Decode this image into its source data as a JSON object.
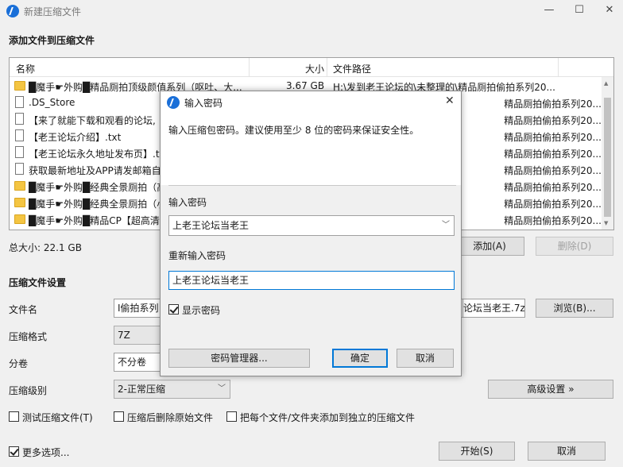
{
  "window": {
    "title": "新建压缩文件",
    "minimize": "—",
    "maximize": "☐",
    "close": "✕"
  },
  "add_section": {
    "title": "添加文件到压缩文件"
  },
  "file_list": {
    "columns": {
      "name": "名称",
      "size": "大小",
      "path": "文件路径"
    },
    "rows": [
      {
        "type": "folder",
        "name": "█魔手☛外购█精品厕拍顶级颜值系列（呕吐、大...",
        "size": "3.67 GB",
        "path": "H:\\发到老王论坛的\\未整理的\\精品厕拍偷拍系列20..."
      },
      {
        "type": "file",
        "name": ".DS_Store",
        "size": "",
        "path": "精品厕拍偷拍系列20..."
      },
      {
        "type": "file",
        "name": "【来了就能下载和观看的论坛,",
        "size": "",
        "path": "精品厕拍偷拍系列20..."
      },
      {
        "type": "file",
        "name": "【老王论坛介绍】.txt",
        "size": "",
        "path": "精品厕拍偷拍系列20..."
      },
      {
        "type": "file",
        "name": "【老王论坛永久地址发布页】.tx",
        "size": "",
        "path": "精品厕拍偷拍系列20..."
      },
      {
        "type": "file",
        "name": "获取最新地址及APP请发邮箱自",
        "size": "",
        "path": "精品厕拍偷拍系列20..."
      },
      {
        "type": "folder",
        "name": "█魔手☛外购█经典全景厕拍（高",
        "size": "",
        "path": "精品厕拍偷拍系列20..."
      },
      {
        "type": "folder",
        "name": "█魔手☛外购█经典全景厕拍（小",
        "size": "",
        "path": "精品厕拍偷拍系列20..."
      },
      {
        "type": "folder",
        "name": "█魔手☛外购█精品CP【超高清",
        "size": "",
        "path": "精品厕拍偷拍系列20..."
      }
    ]
  },
  "total_size": "总大小: 22.1 GB",
  "buttons": {
    "add": "添加(A)",
    "delete": "删除(D)",
    "browse": "浏览(B)...",
    "advanced": "高级设置 »",
    "start": "开始(S)",
    "cancel": "取消"
  },
  "settings": {
    "title": "压缩文件设置",
    "filename_label": "文件名",
    "filename_value_left": "I偷拍系列",
    "filename_value_right": "论坛当老王.7z",
    "format_label": "压缩格式",
    "format_value": "7Z",
    "split_label": "分卷",
    "split_value": "不分卷",
    "level_label": "压缩级别",
    "level_value": "2-正常压缩"
  },
  "options": {
    "test": "测试压缩文件(T)",
    "delete_after": "压缩后删除原始文件",
    "separate": "把每个文件/文件夹添加到独立的压缩文件",
    "more": "更多选项..."
  },
  "dialog": {
    "title": "输入密码",
    "close": "✕",
    "description": "输入压缩包密码。建议使用至少 8 位的密码来保证安全性。",
    "password_label": "输入密码",
    "password_value": "上老王论坛当老王",
    "confirm_label": "重新输入密码",
    "confirm_value": "上老王论坛当老王",
    "show_password": "显示密码",
    "manager_button": "密码管理器...",
    "ok_button": "确定",
    "cancel_button": "取消"
  }
}
